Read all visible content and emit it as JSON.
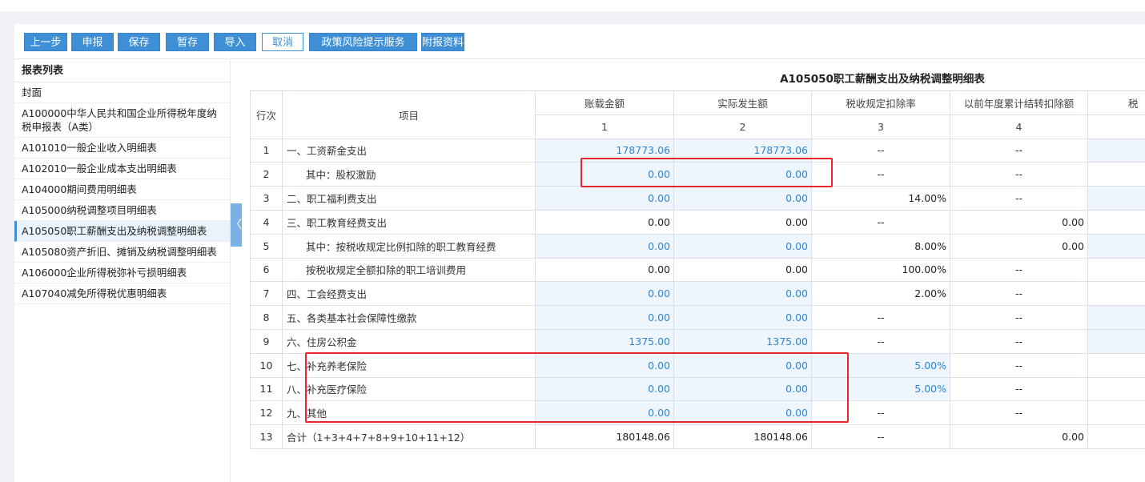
{
  "toolbar": {
    "buttons": [
      "上一步",
      "申报",
      "保存",
      "暂存",
      "导入",
      "取消",
      "政策风险提示服务",
      "附报资料"
    ]
  },
  "sidebar": {
    "title": "报表列表",
    "items": [
      "封面",
      "A100000中华人民共和国企业所得税年度纳税申报表（A类）",
      "A101010一般企业收入明细表",
      "A102010一般企业成本支出明细表",
      "A104000期间费用明细表",
      "A105000纳税调整项目明细表",
      "A105050职工薪酬支出及纳税调整明细表",
      "A105080资产折旧、摊销及纳税调整明细表",
      "A106000企业所得税弥补亏损明细表",
      "A107040减免所得税优惠明细表"
    ],
    "active_index": 6,
    "collapse_glyph": "〈"
  },
  "table": {
    "title": "A105050职工薪酬支出及纳税调整明细表",
    "header": {
      "row_no": "行次",
      "item": "项目",
      "cols": [
        "账载金额",
        "实际发生额",
        "税收规定扣除率",
        "以前年度累计结转扣除额",
        "税"
      ],
      "col_nums": [
        "1",
        "2",
        "3",
        "4",
        ""
      ]
    },
    "rows": [
      {
        "no": "1",
        "item": "一、工资薪金支出",
        "c1": "178773.06",
        "c2": "178773.06",
        "c3": "--",
        "c4": "--"
      },
      {
        "no": "2",
        "item": "其中：股权激励",
        "c1": "0.00",
        "c2": "0.00",
        "c3": "--",
        "c4": "--"
      },
      {
        "no": "3",
        "item": "二、职工福利费支出",
        "c1": "0.00",
        "c2": "0.00",
        "c3": "14.00%",
        "c4": "--"
      },
      {
        "no": "4",
        "item": "三、职工教育经费支出",
        "c1": "0.00",
        "c2": "0.00",
        "c3": "--",
        "c4": "0.00"
      },
      {
        "no": "5",
        "item": "其中：按税收规定比例扣除的职工教育经费",
        "c1": "0.00",
        "c2": "0.00",
        "c3": "8.00%",
        "c4": "0.00"
      },
      {
        "no": "6",
        "item": "按税收规定全额扣除的职工培训费用",
        "c1": "0.00",
        "c2": "0.00",
        "c3": "100.00%",
        "c4": "--"
      },
      {
        "no": "7",
        "item": "四、工会经费支出",
        "c1": "0.00",
        "c2": "0.00",
        "c3": "2.00%",
        "c4": "--"
      },
      {
        "no": "8",
        "item": "五、各类基本社会保障性缴款",
        "c1": "0.00",
        "c2": "0.00",
        "c3": "--",
        "c4": "--"
      },
      {
        "no": "9",
        "item": "六、住房公积金",
        "c1": "1375.00",
        "c2": "1375.00",
        "c3": "--",
        "c4": "--"
      },
      {
        "no": "10",
        "item": "七、补充养老保险",
        "c1": "0.00",
        "c2": "0.00",
        "c3": "5.00%",
        "c4": "--"
      },
      {
        "no": "11",
        "item": "八、补充医疗保险",
        "c1": "0.00",
        "c2": "0.00",
        "c3": "5.00%",
        "c4": "--"
      },
      {
        "no": "12",
        "item": "九、其他",
        "c1": "0.00",
        "c2": "0.00",
        "c3": "--",
        "c4": "--"
      },
      {
        "no": "13",
        "item": "合计（1+3+4+7+8+9+10+11+12）",
        "c1": "180148.06",
        "c2": "180148.06",
        "c3": "--",
        "c4": "0.00"
      }
    ]
  },
  "colors": {
    "primary": "#3f8fd6",
    "editable_bg": "#eef5fd",
    "editable_text": "#2b86d4",
    "highlight": "#e8262e"
  }
}
